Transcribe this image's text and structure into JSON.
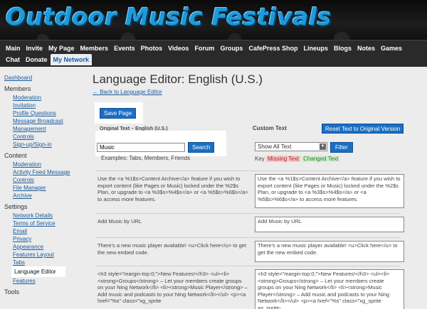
{
  "site": {
    "title": "Outdoor Music Festivals"
  },
  "nav": {
    "items": [
      "Main",
      "Invite",
      "My Page",
      "Members",
      "Events",
      "Photos",
      "Videos",
      "Forum",
      "Groups",
      "CafePress Shop",
      "Lineups",
      "Blogs",
      "Notes",
      "Games",
      "Chat",
      "Donate",
      "My Network"
    ],
    "active": "My Network"
  },
  "sidebar": {
    "dashboard": "Dashboard",
    "members_heading": "Members",
    "members_items": [
      "Moderation",
      "Invitation",
      "Profile Questions",
      "Message Broadcast",
      "Management",
      "Controls",
      "Sign-up/Sign-in"
    ],
    "content_heading": "Content",
    "content_items": [
      "Moderation",
      "Activity Feed Message",
      "Controls",
      "File Manager",
      "Archive"
    ],
    "settings_heading": "Settings",
    "settings_items": [
      "Network Details",
      "Terms of Service",
      "Email",
      "Privacy",
      "Appearance",
      "Features Layout",
      "Tabs"
    ],
    "language_editor": "Language Editor",
    "features": "Features",
    "tools_heading": "Tools"
  },
  "editor": {
    "title": "Language Editor: English (U.S.)",
    "back_link": "← Back to Language Editor",
    "save_label": "Save Page",
    "original_heading": "Original Text – English (U.S.)",
    "custom_heading": "Custom Text",
    "reset_label": "Reset Text to Original Version",
    "search_value": "Music",
    "search_label": "Search",
    "examples": "Examples: Tabs, Members, Friends",
    "filter_value": "Show All Text",
    "filter_label": "Filter",
    "key_label": "Key",
    "key_missing": "Missing Text",
    "key_changed": "Changed Text",
    "rows": [
      {
        "original": "Use the <a %1$s>Content Archive</a> feature if you wish to export content (like Pages or Music) locked under the %2$s Plan, or upgrade to <a %3$s>%4$s</a> or <a %5$s>%6$s</a> to access more features.",
        "custom": "Use the <a %1$s>Content Archive</a> feature if you wish to export content (like Pages or Music) locked under the %2$s Plan, or upgrade to <a %3$s>%4$s</a> or <a %5$s>%6$s</a> to access more features."
      },
      {
        "original": "Add Music by URL",
        "custom": "Add Music by URL"
      },
      {
        "original": "There's a new music player available! <u>Click here</u> to get the new embed code.",
        "custom": "There's a new music player available! <u>Click here</u> to get the new embed code."
      },
      {
        "original": "<h3 style=\"margin-top:0;\">New Features!</h3> <ul><li><strong>Groups</strong> – Let your members create groups on your Ning Network</li> <li><strong>Music Player</strong> – Add music and podcasts to your Ning Network</li></ul> <p><a href=\"%s\" class=\"xg_sprite",
        "custom": "<h3 style=\"margin-top:0;\">New Features!</h3> <ul><li><strong>Groups</strong> – Let your members create groups on your Ning Network</li> <li><strong>Music Player</strong> – Add music and podcasts to your Ning Network</li></ul> <p><a href=\"%s\" class=\"xg_sprite xg_sprite-"
      }
    ]
  }
}
